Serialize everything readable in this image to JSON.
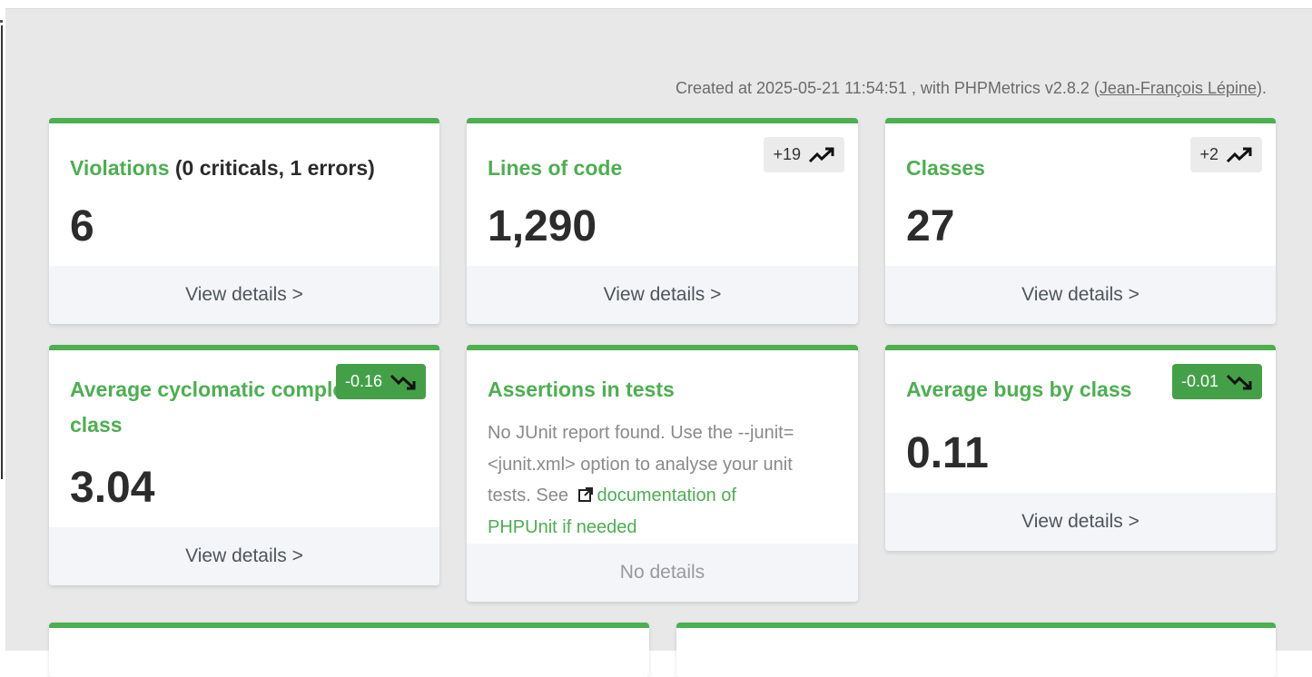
{
  "header": {
    "created_prefix": "Created at 2025-05-21 11:54:51 , with PHPMetrics v2.8.2 (",
    "author": "Jean-François Lépine",
    "created_suffix": ")."
  },
  "cards": {
    "violations": {
      "title": "Violations",
      "extra": " (0 criticals, 1 errors)",
      "value": "6",
      "footer": "View details >"
    },
    "loc": {
      "title": "Lines of code",
      "value": "1,290",
      "badge": "+19",
      "badge_icon": "trending-up-icon",
      "footer": "View details >"
    },
    "classes": {
      "title": "Classes",
      "value": "27",
      "badge": "+2",
      "badge_icon": "trending-up-icon",
      "footer": "View details >"
    },
    "complexity": {
      "title_line1": "Average cyclomatic comple",
      "title_line2": "class",
      "value": "3.04",
      "badge": "-0.16",
      "badge_icon": "trending-down-icon",
      "footer": "View details >"
    },
    "assertions": {
      "title": "Assertions in tests",
      "desc_line1": "No JUnit report found. Use the --junit=",
      "desc_line2": "<junit.xml> option to analyse your unit",
      "desc_line3_prefix": "tests. See",
      "link_line1": "documentation of",
      "link_line2": "PHPUnit if needed",
      "footer": "No details"
    },
    "bugs": {
      "title": "Average bugs by class",
      "value": "0.11",
      "badge": "-0.01",
      "badge_icon": "trending-down-icon",
      "footer": "View details >"
    }
  },
  "colors": {
    "accent": "#4caf50",
    "badge_green": "#43a047",
    "badge_gray": "#ebebeb",
    "footer_bg": "#f3f5f8",
    "page_bg": "#e8e8e8"
  }
}
